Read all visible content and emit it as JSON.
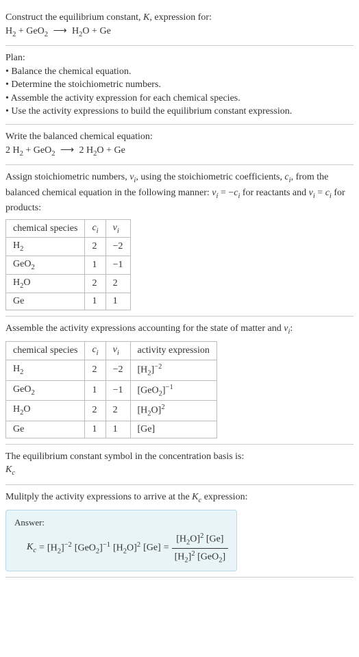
{
  "intro": {
    "line1": "Construct the equilibrium constant, ",
    "K": "K",
    "line1b": ", expression for:",
    "eq": {
      "H2": "H",
      "s2": "2",
      "plus": " + ",
      "GeO2": "GeO",
      "arrow": "⟶",
      "H2O": "H",
      "O": "O",
      "Ge": "Ge"
    }
  },
  "plan": {
    "title": "Plan:",
    "b1": "• Balance the chemical equation.",
    "b2": "• Determine the stoichiometric numbers.",
    "b3": "• Assemble the activity expression for each chemical species.",
    "b4": "• Use the activity expressions to build the equilibrium constant expression."
  },
  "balanced": {
    "title": "Write the balanced chemical equation:",
    "c1": "2 ",
    "c2": "2 "
  },
  "stoich": {
    "text1": "Assign stoichiometric numbers, ",
    "nu": "ν",
    "i": "i",
    "text2": ", using the stoichiometric coefficients, ",
    "c": "c",
    "text3": ", from the balanced chemical equation in the following manner: ",
    "eq1a": " = −",
    "text4": " for reactants and ",
    "eq2a": " = ",
    "text5": " for products:",
    "table": {
      "h1": "chemical species",
      "h2": "c",
      "h3": "ν",
      "rows": [
        {
          "sp": "H",
          "sub": "2",
          "c": "2",
          "nu": "−2"
        },
        {
          "sp": "GeO",
          "sub": "2",
          "c": "1",
          "nu": "−1"
        },
        {
          "sp": "H",
          "sub": "2",
          "tail": "O",
          "c": "2",
          "nu": "2"
        },
        {
          "sp": "Ge",
          "sub": "",
          "c": "1",
          "nu": "1"
        }
      ]
    }
  },
  "activity": {
    "text1": "Assemble the activity expressions accounting for the state of matter and ",
    "colon": ":",
    "table": {
      "h1": "chemical species",
      "h2": "c",
      "h3": "ν",
      "h4": "activity expression",
      "rows": [
        {
          "sp": "H",
          "sub": "2",
          "c": "2",
          "nu": "−2",
          "act": "[H",
          "asub": "2",
          "atail": "]",
          "exp": "−2"
        },
        {
          "sp": "GeO",
          "sub": "2",
          "c": "1",
          "nu": "−1",
          "act": "[GeO",
          "asub": "2",
          "atail": "]",
          "exp": "−1"
        },
        {
          "sp": "H",
          "sub": "2",
          "tail": "O",
          "c": "2",
          "nu": "2",
          "act": "[H",
          "asub": "2",
          "atail": "O]",
          "exp": "2"
        },
        {
          "sp": "Ge",
          "sub": "",
          "c": "1",
          "nu": "1",
          "act": "[Ge]",
          "asub": "",
          "atail": "",
          "exp": ""
        }
      ]
    }
  },
  "symbol": {
    "text": "The equilibrium constant symbol in the concentration basis is:",
    "K": "K",
    "c": "c"
  },
  "multiply": {
    "text1": "Mulitply the activity expressions to arrive at the ",
    "K": "K",
    "c": "c",
    "text2": " expression:"
  },
  "answer": {
    "label": "Answer:",
    "K": "K",
    "c": "c",
    "eq": " = ",
    "t1": "[H",
    "t1s": "2",
    "t1e": "]",
    "e1": "−2",
    "sp": " ",
    "t2": "[GeO",
    "t2s": "2",
    "t2e": "]",
    "e2": "−1",
    "t3": "[H",
    "t3s": "2",
    "t3e": "O]",
    "e3": "2",
    "t4": "[Ge]",
    "num1": "[H",
    "num1s": "2",
    "num1e": "O]",
    "nume": "2",
    "num2": " [Ge]",
    "den1": "[H",
    "den1s": "2",
    "den1e": "]",
    "dene": "2",
    "den2": " [GeO",
    "den2s": "2",
    "den2e": "]"
  }
}
